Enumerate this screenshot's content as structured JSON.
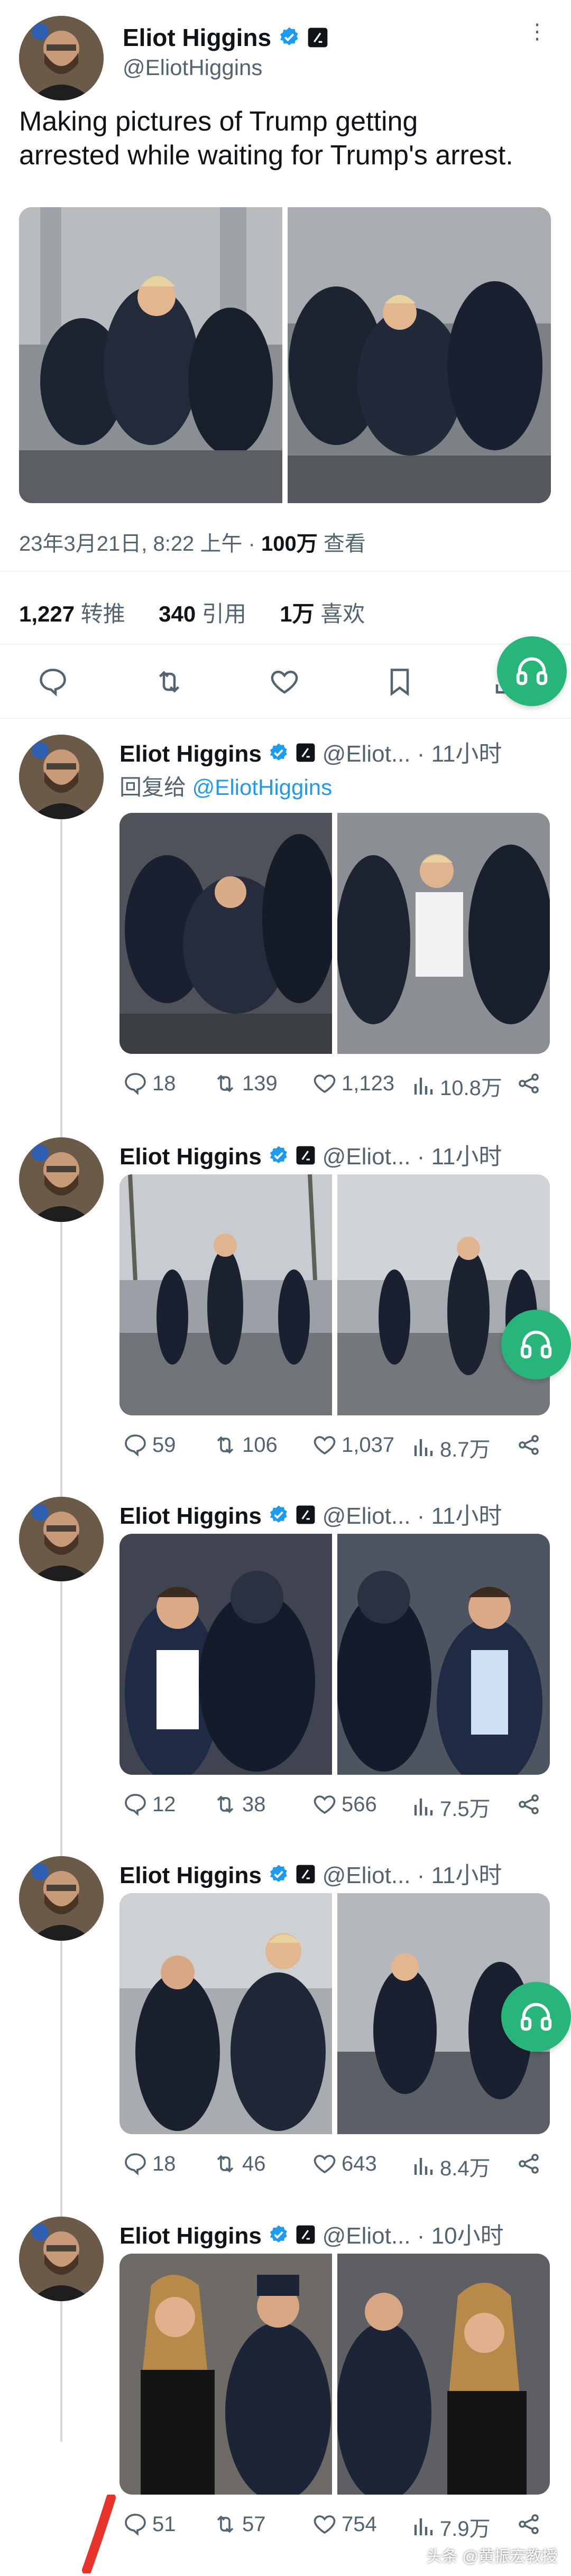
{
  "main_tweet": {
    "author_name": "Eliot Higgins",
    "author_handle": "@EliotHiggins",
    "text_line1": "Making pictures of Trump getting",
    "text_line2": "arrested while waiting for Trump's arrest.",
    "timestamp": "23年3月21日, 8:22 上午 · ",
    "views_count": "100万",
    "views_label": " 查看",
    "retweets_count": "1,227",
    "retweets_label": "转推",
    "quotes_count": "340",
    "quotes_label": "引用",
    "likes_count": "1万",
    "likes_label": "喜欢"
  },
  "replies": [
    {
      "name": "Eliot Higgins",
      "handle": "@Eliot...",
      "time": "· 11小时",
      "reply_to_prefix": "回复给 ",
      "reply_to_handle": "@EliotHiggins",
      "replies": "18",
      "retweets": "139",
      "likes": "1,123",
      "views": "10.8万"
    },
    {
      "name": "Eliot Higgins",
      "handle": "@Eliot...",
      "time": "· 11小时",
      "replies": "59",
      "retweets": "106",
      "likes": "1,037",
      "views": "8.7万"
    },
    {
      "name": "Eliot Higgins",
      "handle": "@Eliot...",
      "time": "· 11小时",
      "replies": "12",
      "retweets": "38",
      "likes": "566",
      "views": "7.5万"
    },
    {
      "name": "Eliot Higgins",
      "handle": "@Eliot...",
      "time": "· 11小时",
      "replies": "18",
      "retweets": "46",
      "likes": "643",
      "views": "8.4万"
    },
    {
      "name": "Eliot Higgins",
      "handle": "@Eliot...",
      "time": "· 10小时",
      "replies": "51",
      "retweets": "57",
      "likes": "754",
      "views": "7.9万"
    }
  ],
  "watermark": "头条 @黄振宏教授",
  "colors": {
    "accent": "#1d9bf0",
    "fab": "#27b57a",
    "muted": "#536471"
  }
}
